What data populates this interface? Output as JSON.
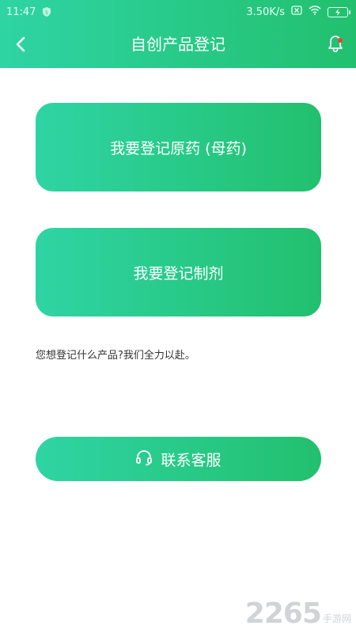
{
  "status_bar": {
    "time": "11:47",
    "network_speed": "3.50K/s",
    "battery_level": "53"
  },
  "header": {
    "title": "自创产品登记",
    "back_icon": "chevron-left-icon",
    "notification_icon": "bell-icon",
    "notification_dot_color": "#ff3b30"
  },
  "actions": {
    "register_original": "我要登记原药 (母药)",
    "register_formulation": "我要登记制剂"
  },
  "hint": "您想登记什么产品?我们全力以赴。",
  "contact": {
    "label": "联系客服",
    "icon": "headset-icon"
  },
  "watermark": {
    "number": "2265",
    "text": "手游网"
  },
  "colors": {
    "gradient_start": "#2fd4a4",
    "gradient_end": "#22c06e",
    "background": "#ffffff"
  }
}
